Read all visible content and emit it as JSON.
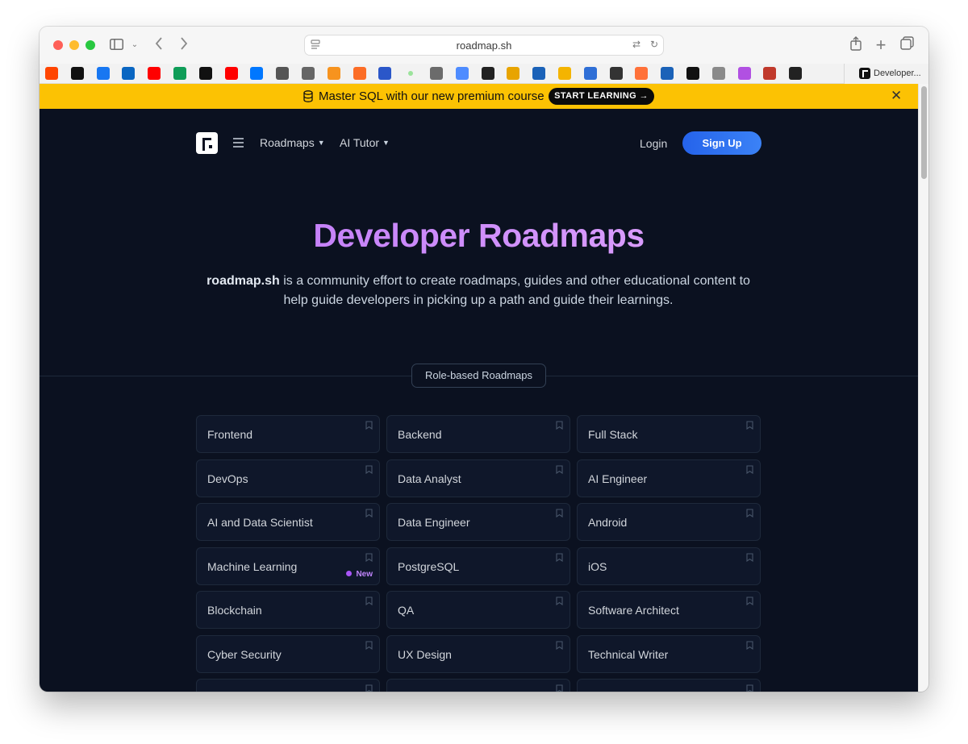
{
  "browser": {
    "url": "roadmap.sh",
    "favorites": [
      {
        "name": "reddit-icon",
        "color": "#ff4500"
      },
      {
        "name": "threads-icon",
        "color": "#111111"
      },
      {
        "name": "facebook-icon",
        "color": "#1877f2"
      },
      {
        "name": "linkedin-icon",
        "color": "#0a66c2"
      },
      {
        "name": "youtube-icon",
        "color": "#ff0000"
      },
      {
        "name": "sheets-icon",
        "color": "#0f9d58"
      },
      {
        "name": "x-icon",
        "color": "#111111"
      },
      {
        "name": "youtube-icon",
        "color": "#ff0000"
      },
      {
        "name": "vk-icon",
        "color": "#0077ff"
      },
      {
        "name": "globe-icon",
        "color": "#555555"
      },
      {
        "name": "compass-icon",
        "color": "#666666"
      },
      {
        "name": "odnoklassniki-icon",
        "color": "#f7931e"
      },
      {
        "name": "gitlab-icon",
        "color": "#fc6d26"
      },
      {
        "name": "x-tool-icon",
        "color": "#2b57c9"
      },
      {
        "name": "dot-icon",
        "color": "#9be39b"
      },
      {
        "name": "avatar-icon",
        "color": "#6b6b6b"
      },
      {
        "name": "gemini-icon",
        "color": "#4e8cff"
      },
      {
        "name": "media-icon",
        "color": "#222222"
      },
      {
        "name": "chrome-icon",
        "color": "#e8a400"
      },
      {
        "name": "text-t-icon",
        "color": "#1b62b8"
      },
      {
        "name": "analytics-icon",
        "color": "#f4b400"
      },
      {
        "name": "rocket-icon",
        "color": "#2f6fd6"
      },
      {
        "name": "openai-icon",
        "color": "#333333"
      },
      {
        "name": "firefox-icon",
        "color": "#ff7139"
      },
      {
        "name": "text-t-icon",
        "color": "#1b62b8"
      },
      {
        "name": "chevron-right-icon",
        "color": "#111111"
      },
      {
        "name": "g-icon",
        "color": "#8a8a8a"
      },
      {
        "name": "podcast-icon",
        "color": "#b150e2"
      },
      {
        "name": "code-icon",
        "color": "#c0392b"
      },
      {
        "name": "anthropic-icon",
        "color": "#222222"
      }
    ],
    "tab_label": "Developer..."
  },
  "promo": {
    "text": "Master SQL with our new premium course",
    "cta": "START LEARNING →",
    "color": "#fcc203"
  },
  "nav": {
    "roadmaps": "Roadmaps",
    "ai_tutor": "AI Tutor",
    "login": "Login",
    "signup": "Sign Up"
  },
  "hero": {
    "title": "Developer Roadmaps",
    "sub_brand": "roadmap.sh",
    "sub_rest": " is a community effort to create roadmaps, guides and other educational content to help guide developers in picking up a path and guide their learnings."
  },
  "section": {
    "title": "Role-based Roadmaps"
  },
  "roadmaps": [
    {
      "label": "Frontend",
      "badge": ""
    },
    {
      "label": "Backend",
      "badge": ""
    },
    {
      "label": "Full Stack",
      "badge": ""
    },
    {
      "label": "DevOps",
      "badge": ""
    },
    {
      "label": "Data Analyst",
      "badge": ""
    },
    {
      "label": "AI Engineer",
      "badge": ""
    },
    {
      "label": "AI and Data Scientist",
      "badge": ""
    },
    {
      "label": "Data Engineer",
      "badge": ""
    },
    {
      "label": "Android",
      "badge": ""
    },
    {
      "label": "Machine Learning",
      "badge": "New"
    },
    {
      "label": "PostgreSQL",
      "badge": ""
    },
    {
      "label": "iOS",
      "badge": ""
    },
    {
      "label": "Blockchain",
      "badge": ""
    },
    {
      "label": "QA",
      "badge": ""
    },
    {
      "label": "Software Architect",
      "badge": ""
    },
    {
      "label": "Cyber Security",
      "badge": ""
    },
    {
      "label": "UX Design",
      "badge": ""
    },
    {
      "label": "Technical Writer",
      "badge": ""
    },
    {
      "label": "",
      "badge": ""
    },
    {
      "label": "",
      "badge": ""
    },
    {
      "label": "",
      "badge": ""
    }
  ]
}
